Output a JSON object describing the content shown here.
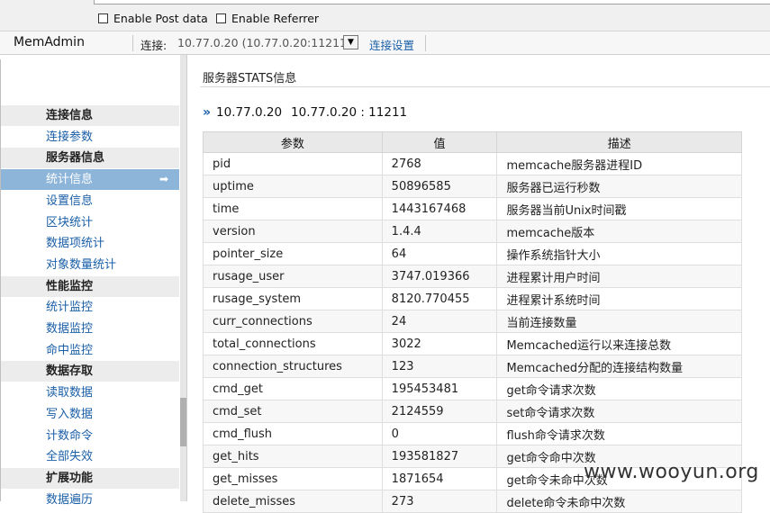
{
  "browser": {
    "enable_post_label": "Enable Post data",
    "enable_referrer_label": "Enable Referrer"
  },
  "header": {
    "brand": "MemAdmin",
    "connection_label": "连接:",
    "connection_value": "10.77.0.20 (10.77.0.20:11211)",
    "dropdown_glyph": "▼",
    "connection_settings": "连接设置"
  },
  "sidebar": {
    "items": [
      {
        "label": "连接信息",
        "type": "group"
      },
      {
        "label": "连接参数",
        "type": "link"
      },
      {
        "label": "服务器信息",
        "type": "group"
      },
      {
        "label": "统计信息",
        "type": "active"
      },
      {
        "label": "设置信息",
        "type": "link"
      },
      {
        "label": "区块统计",
        "type": "link"
      },
      {
        "label": "数据项统计",
        "type": "link"
      },
      {
        "label": "对象数量统计",
        "type": "link"
      },
      {
        "label": "性能监控",
        "type": "group"
      },
      {
        "label": "统计监控",
        "type": "link"
      },
      {
        "label": "数据监控",
        "type": "link"
      },
      {
        "label": "命中监控",
        "type": "link"
      },
      {
        "label": "数据存取",
        "type": "group"
      },
      {
        "label": "读取数据",
        "type": "link"
      },
      {
        "label": "写入数据",
        "type": "link"
      },
      {
        "label": "计数命令",
        "type": "link"
      },
      {
        "label": "全部失效",
        "type": "link"
      },
      {
        "label": "扩展功能",
        "type": "group"
      },
      {
        "label": "数据遍历",
        "type": "link"
      }
    ]
  },
  "main": {
    "title": "服务器STATS信息",
    "server_ip": "10.77.0.20",
    "server_addr": "10.77.0.20 : 11211",
    "table": {
      "headers": [
        "参数",
        "值",
        "描述"
      ],
      "rows": [
        [
          "pid",
          "2768",
          "memcache服务器进程ID"
        ],
        [
          "uptime",
          "50896585",
          "服务器已运行秒数"
        ],
        [
          "time",
          "1443167468",
          "服务器当前Unix时间戳"
        ],
        [
          "version",
          "1.4.4",
          "memcache版本"
        ],
        [
          "pointer_size",
          "64",
          "操作系统指针大小"
        ],
        [
          "rusage_user",
          "3747.019366",
          "进程累计用户时间"
        ],
        [
          "rusage_system",
          "8120.770455",
          "进程累计系统时间"
        ],
        [
          "curr_connections",
          "24",
          "当前连接数量"
        ],
        [
          "total_connections",
          "3022",
          "Memcached运行以来连接总数"
        ],
        [
          "connection_structures",
          "123",
          "Memcached分配的连接结构数量"
        ],
        [
          "cmd_get",
          "195453481",
          "get命令请求次数"
        ],
        [
          "cmd_set",
          "2124559",
          "set命令请求次数"
        ],
        [
          "cmd_flush",
          "0",
          "flush命令请求次数"
        ],
        [
          "get_hits",
          "193581827",
          "get命令命中次数"
        ],
        [
          "get_misses",
          "1871654",
          "get命令未命中次数"
        ],
        [
          "delete_misses",
          "273",
          "delete命令未命中次数"
        ]
      ]
    }
  },
  "watermark": "www.wooyun.org",
  "colors": {
    "link": "#1a5fa8",
    "active_bg": "#8db4d9",
    "group_bg": "#ececec"
  }
}
